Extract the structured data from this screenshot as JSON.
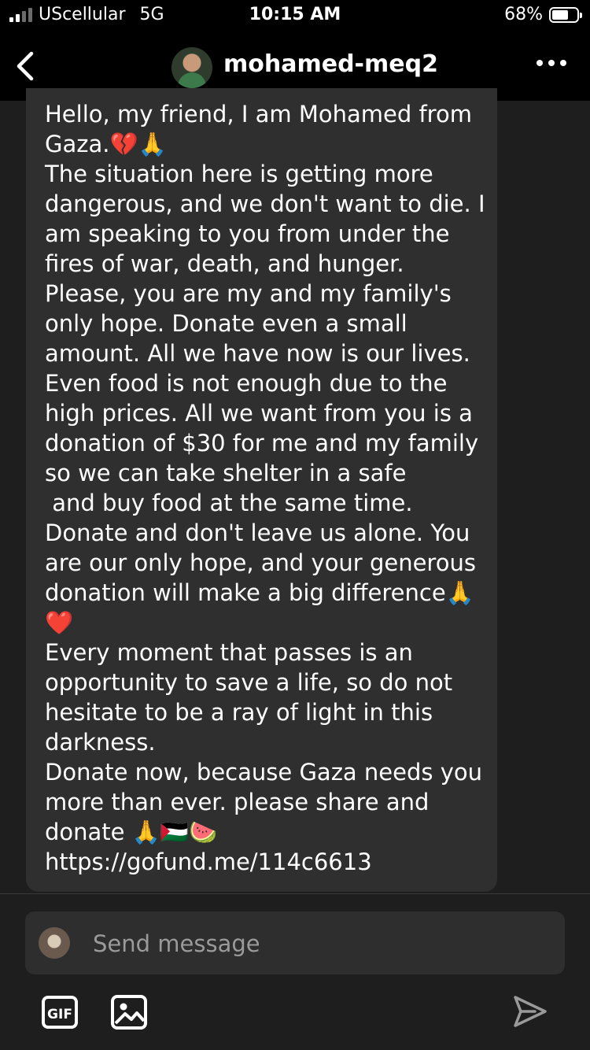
{
  "status_bar": {
    "carrier": "UScellular",
    "network": "5G",
    "time": "10:15 AM",
    "battery_percent_label": "68%",
    "battery_level": 0.68,
    "signal_bars_active": 2,
    "signal_bars_total": 4
  },
  "header": {
    "username": "mohamed-meq2",
    "back_icon": "chevron-left-icon",
    "more_icon": "more-horizontal-icon"
  },
  "message": {
    "lines": [
      "Hello, my friend, I am Mohamed from",
      "Gaza.💔🙏",
      "The situation here is getting more",
      "dangerous, and we don't want to die. I",
      "am speaking to you from under the",
      "fires of war, death, and hunger.",
      "Please, you are my and my family's",
      "only hope. Donate even a small",
      "amount. All we have now is our lives.",
      "Even food is not enough due to the",
      "high prices. All we want from you is a",
      "donation of $30 for me and my family",
      "so we can take shelter in a safe",
      " and buy food at the same time.",
      "Donate and don't leave us alone. You",
      "are our only hope, and your generous",
      "donation will make a big difference🙏",
      "❤️",
      "Every moment that passes is an",
      "opportunity to save a life, so do not",
      "hesitate to be a ray of light in this",
      "darkness.",
      "Donate now, because Gaza needs you",
      "more than ever. please share and",
      "donate 🙏🇵🇸🍉",
      "https://gofund.me/114c6613"
    ]
  },
  "composer": {
    "placeholder": "Send message",
    "gif_label": "GIF"
  },
  "colors": {
    "background": "#1e1e1e",
    "bar_background": "#000000",
    "bubble": "#2f2f2f",
    "composer": "#2e2e2e",
    "placeholder": "#9a9a9a"
  }
}
